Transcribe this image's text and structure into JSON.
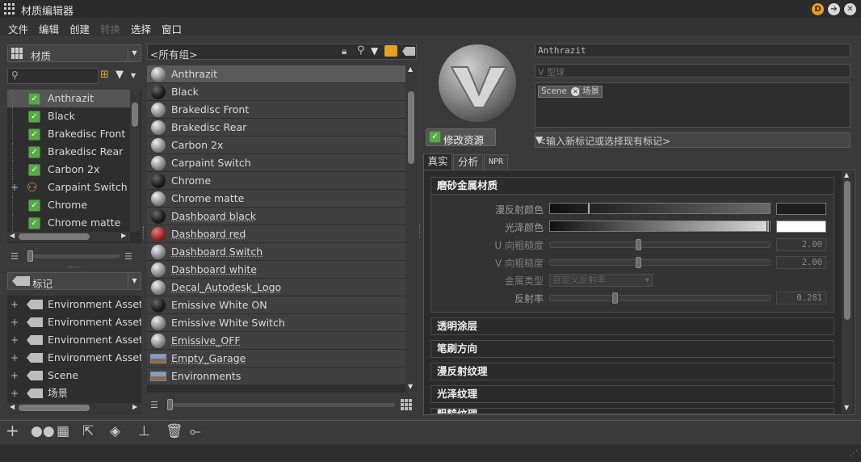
{
  "window": {
    "title": "材质编辑器"
  },
  "menu": [
    {
      "label": "文件",
      "enabled": true
    },
    {
      "label": "编辑",
      "enabled": true
    },
    {
      "label": "创建",
      "enabled": true
    },
    {
      "label": "转换",
      "enabled": false
    },
    {
      "label": "选择",
      "enabled": true
    },
    {
      "label": "窗口",
      "enabled": true
    }
  ],
  "left_panel": {
    "dropdown_label": "材质",
    "search_placeholder": "",
    "tree_items": [
      "Anthrazit",
      "Black",
      "Brakedisc Front",
      "Brakedisc Rear",
      "Carbon 2x",
      "Carpaint Switch",
      "Chrome",
      "Chrome matte"
    ],
    "tag_dropdown_label": "标记",
    "tag_items": [
      "Environment Asset:",
      "Environment Asset:",
      "Environment Asset:",
      "Environment Asset:",
      "Scene",
      "场景"
    ]
  },
  "middle_panel": {
    "group_label": "<所有组>",
    "items": [
      {
        "name": "Anthrazit",
        "underline": false,
        "icon": "gray-sphere"
      },
      {
        "name": "Black",
        "underline": false,
        "icon": "black-sphere"
      },
      {
        "name": "Brakedisc Front",
        "underline": false,
        "icon": "gray-sphere"
      },
      {
        "name": "Brakedisc Rear",
        "underline": false,
        "icon": "gray-sphere"
      },
      {
        "name": "Carbon 2x",
        "underline": false,
        "icon": "gray-sphere"
      },
      {
        "name": "Carpaint Switch",
        "underline": false,
        "icon": "switch-sphere"
      },
      {
        "name": "Chrome",
        "underline": false,
        "icon": "black-sphere"
      },
      {
        "name": "Chrome matte",
        "underline": false,
        "icon": "gray-sphere"
      },
      {
        "name": "Dashboard black",
        "underline": true,
        "icon": "black-sphere"
      },
      {
        "name": "Dashboard red",
        "underline": true,
        "icon": "red-sphere"
      },
      {
        "name": "Dashboard Switch",
        "underline": true,
        "icon": "switch-sphere"
      },
      {
        "name": "Dashboard white",
        "underline": true,
        "icon": "gray-sphere"
      },
      {
        "name": "Decal_Autodesk_Logo",
        "underline": true,
        "icon": "gray-sphere"
      },
      {
        "name": "Emissive White ON",
        "underline": false,
        "icon": "black-sphere"
      },
      {
        "name": "Emissive White Switch",
        "underline": false,
        "icon": "switch-sphere"
      },
      {
        "name": "Emissive_OFF",
        "underline": true,
        "icon": "gray-sphere"
      },
      {
        "name": "Empty_Garage",
        "underline": true,
        "icon": "environment"
      },
      {
        "name": "Environments",
        "underline": false,
        "icon": "environment"
      }
    ]
  },
  "right_panel": {
    "material_name": "Anthrazit",
    "type_label": "V 型球",
    "tags": [
      "Scene",
      "场景"
    ],
    "tag_input_placeholder": "<输入新标记或选择现有标记>",
    "modify_asset_label": "修改资源",
    "tabs": [
      "真实",
      "分析",
      "NPR"
    ],
    "sections": {
      "main_title": "磨砂金属材质",
      "properties": {
        "diffuse_color_label": "漫反射颜色",
        "diffuse_color": "#1e1e1e",
        "gloss_color_label": "光泽颜色",
        "gloss_color": "#ffffff",
        "u_roughness_label": "U 向粗糙度",
        "u_roughness_value": "2.00",
        "v_roughness_label": "V 向粗糙度",
        "v_roughness_value": "2.00",
        "metal_type_label": "金属类型",
        "metal_type_value": "自定义反射率",
        "reflectivity_label": "反射率",
        "reflectivity_value": "0.281"
      },
      "collapsed": [
        "透明涂层",
        "笔刷方向",
        "漫反射纹理",
        "光泽纹理",
        "粗糙纹理"
      ]
    }
  },
  "colors": {
    "accent_green": "#5aa84a",
    "win_btn_orange": "#e8a020"
  }
}
